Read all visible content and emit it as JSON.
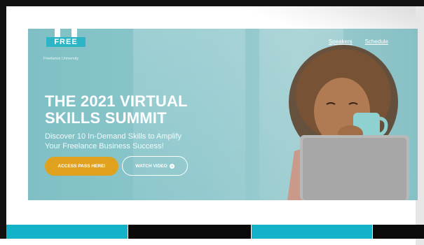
{
  "logo": {
    "ribbon_text": "FREE",
    "name": "Freelance University"
  },
  "nav": {
    "items": [
      "Speakers",
      "Schedule"
    ]
  },
  "hero": {
    "title_line1": "THE 2021 VIRTUAL",
    "title_line2": "SKILLS SUMMIT",
    "subtitle_line1": "Discover 10 In-Demand Skills to Amplify",
    "subtitle_line2": "Your Freelance Business Success!",
    "primary_button": "ACCESS PASS HERE!",
    "secondary_button": "WATCH VIDEO"
  },
  "colors": {
    "accent_yellow": "#e0a21e",
    "teal": "#14b2c8",
    "hero_overlay": "#8dc7cc"
  },
  "icons": {
    "play": "play-circle-icon",
    "logo": "freelance-university-logo"
  }
}
